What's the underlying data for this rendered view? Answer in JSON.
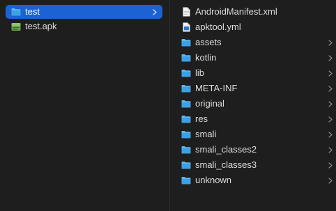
{
  "left_column": {
    "items": [
      {
        "label": "test",
        "icon": "folder-icon",
        "selected": true,
        "has_children": true
      },
      {
        "label": "test.apk",
        "icon": "apk-file-icon",
        "selected": false,
        "has_children": false
      }
    ]
  },
  "right_column": {
    "items": [
      {
        "label": "AndroidManifest.xml",
        "icon": "document-icon",
        "has_children": false
      },
      {
        "label": "apktool.yml",
        "icon": "yml-file-icon",
        "has_children": false
      },
      {
        "label": "assets",
        "icon": "folder-icon",
        "has_children": true
      },
      {
        "label": "kotlin",
        "icon": "folder-icon",
        "has_children": true
      },
      {
        "label": "lib",
        "icon": "folder-icon",
        "has_children": true
      },
      {
        "label": "META-INF",
        "icon": "folder-icon",
        "has_children": true
      },
      {
        "label": "original",
        "icon": "folder-icon",
        "has_children": true
      },
      {
        "label": "res",
        "icon": "folder-icon",
        "has_children": true
      },
      {
        "label": "smali",
        "icon": "folder-icon",
        "has_children": true
      },
      {
        "label": "smali_classes2",
        "icon": "folder-icon",
        "has_children": true
      },
      {
        "label": "smali_classes3",
        "icon": "folder-icon",
        "has_children": true
      },
      {
        "label": "unknown",
        "icon": "folder-icon",
        "has_children": true
      }
    ]
  },
  "colors": {
    "background": "#1e1e1e",
    "selection": "#1b63d3",
    "folder": "#4aa8e8",
    "text": "#dcdcdc",
    "chevron": "#8a8a8a"
  }
}
